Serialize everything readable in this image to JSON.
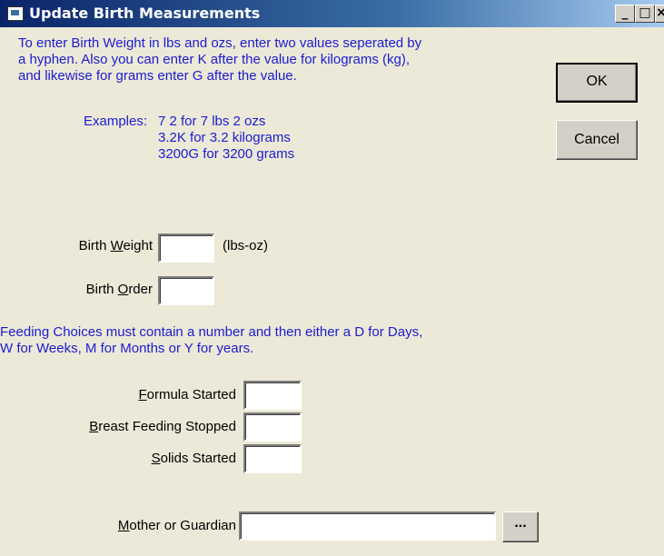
{
  "window": {
    "title": "Update Birth Measurements",
    "controls": {
      "minimize": "_",
      "maximize": "□",
      "close": "×"
    }
  },
  "intro": {
    "line1": "To enter Birth Weight in lbs and ozs, enter two values seperated by",
    "line2": "a hyphen. Also you can  enter K after the value for kilograms (kg),",
    "line3": "and likewise for grams enter G after the value."
  },
  "examples": {
    "label": "Examples:",
    "ex1": "7 2 for 7 lbs 2 ozs",
    "ex2": "3.2K for 3.2 kilograms",
    "ex3": "3200G for 3200 grams"
  },
  "buttons": {
    "ok": "OK",
    "cancel": "Cancel",
    "browse": "..."
  },
  "birth_weight": {
    "pre": "Birth ",
    "key": "W",
    "post": "eight",
    "unit": "(lbs-oz)",
    "value": ""
  },
  "birth_order": {
    "pre": "Birth ",
    "key": "O",
    "post": "rder",
    "value": ""
  },
  "feeding_note": {
    "line1": "Feeding Choices must contain a number and then either a D for Days,",
    "line2": "W for Weeks, M for Months or Y for years."
  },
  "formula_started": {
    "key": "F",
    "post": "ormula Started",
    "value": ""
  },
  "breast_feeding_stopped": {
    "key": "B",
    "post": "reast Feeding Stopped",
    "value": ""
  },
  "solids_started": {
    "key": "S",
    "post": "olids Started",
    "value": ""
  },
  "mother_guardian": {
    "key": "M",
    "post": "other or Guardian",
    "value": ""
  }
}
